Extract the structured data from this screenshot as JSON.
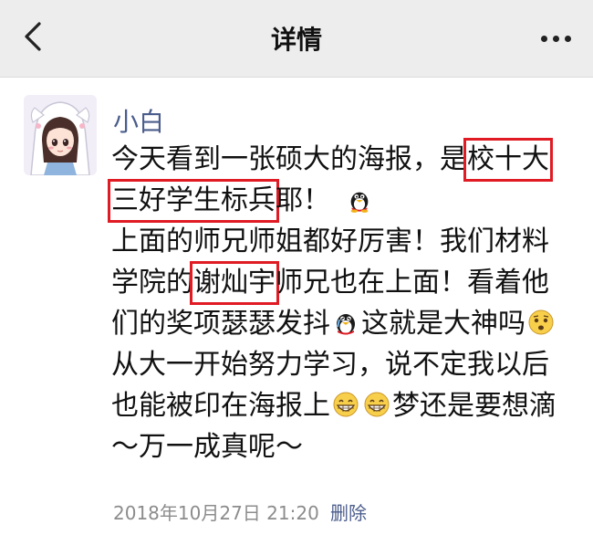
{
  "header": {
    "title": "详情",
    "back_icon": "chevron-left-icon",
    "more_icon": "more-dots-icon"
  },
  "post": {
    "author": "小白",
    "avatar_icon": "anime-girl-avatar",
    "lines": [
      {
        "a": "今天看到一张硕大的海报，是",
        "h": "校十大"
      },
      {
        "h": "三好学生标兵",
        "a": "耶！"
      },
      {
        "a": "上面的师兄师姐都好厉害！我们材料"
      },
      {
        "a": "学院的",
        "h": "谢灿宇",
        "b": "师兄也在上面！看着他"
      },
      {
        "a": "们的奖项瑟瑟发抖",
        "b": "这就是大神吗"
      },
      {
        "a": "从大一开始努力学习，说不定我以后"
      },
      {
        "a": "也能被印在海报上",
        "b": "梦还是要想滴"
      },
      {
        "a": "～万一成真呢～"
      }
    ],
    "timestamp": "2018年10月27日 21:20",
    "delete_label": "删除",
    "highlight_color": "#e01b24",
    "author_color": "#4b5d8c"
  }
}
